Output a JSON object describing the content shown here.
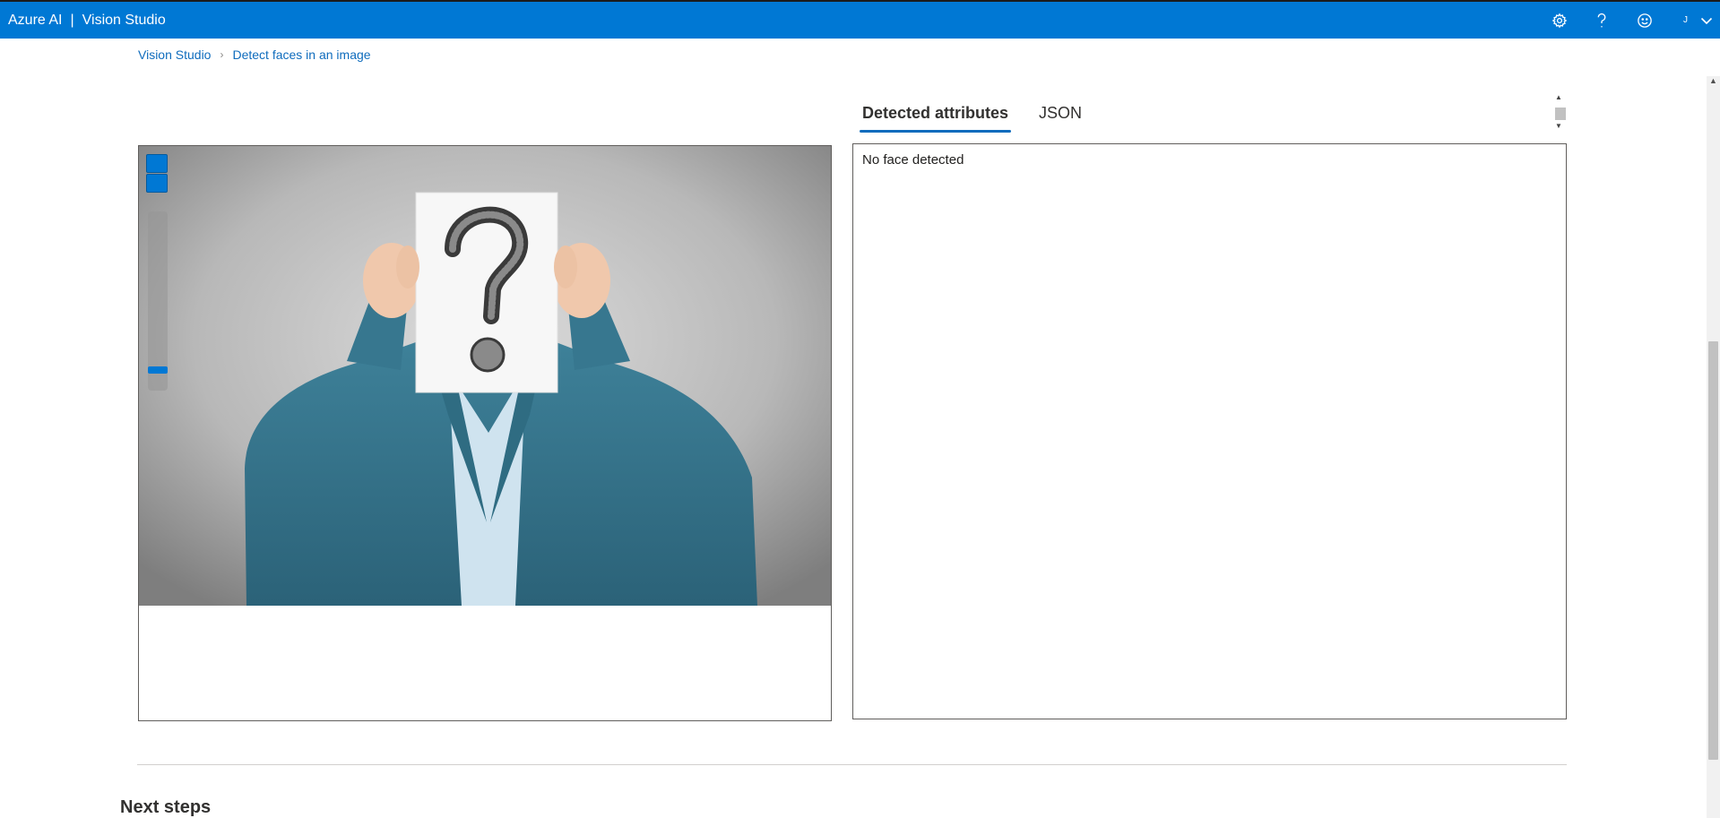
{
  "header": {
    "brand": "Azure AI",
    "separator": "|",
    "app_name": "Vision Studio",
    "icons": [
      "gear-icon",
      "help-icon",
      "smiley-icon",
      "chevron-down-icon"
    ],
    "avatar_initial": "J"
  },
  "breadcrumb": {
    "items": [
      "Vision Studio",
      "Detect faces in an image"
    ],
    "separator_icon": "chevron-right-icon"
  },
  "image_viewer": {
    "image_description_icon": "person-holding-question-mark-sign",
    "zoom_level_fraction": 0.9
  },
  "result_tabs": {
    "tabs": [
      "Detected attributes",
      "JSON"
    ],
    "active": "Detected attributes"
  },
  "result": {
    "message": "No face detected"
  },
  "next_steps": {
    "heading": "Next steps"
  },
  "colors": {
    "topbar": "#0078d4",
    "link": "#0f6cbd",
    "accent": "#0078d4"
  }
}
